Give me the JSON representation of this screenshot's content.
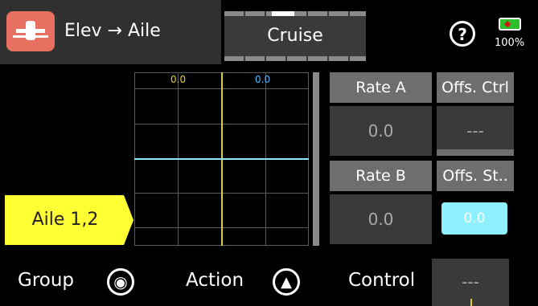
{
  "header": {
    "title": "Elev → Aile",
    "phase": "Cruise",
    "battery": "100%",
    "help_glyph": "?"
  },
  "graph": {
    "left_value": "0.0",
    "right_value": "0.0"
  },
  "side_tab": {
    "label": "Aile 1,2"
  },
  "rates": {
    "rate_a_label": "Rate A",
    "rate_a_value": "0.0",
    "rate_b_label": "Rate B",
    "rate_b_value": "0.0",
    "offs_ctrl_label": "Offs. Ctrl",
    "offs_ctrl_value": "---",
    "offs_st_label": "Offs. St..",
    "offs_st_value": "0.0"
  },
  "bottom": {
    "group_label": "Group",
    "action_label": "Action",
    "control_label": "Control",
    "control_value": "---"
  },
  "icons": {
    "app": "elev-aile-mixer-icon",
    "help": "help-icon",
    "battery": "battery-icon",
    "group": "globe-icon",
    "action": "action-icon"
  },
  "colors": {
    "accent_yellow": "#ffff33",
    "app_icon_bg": "#e87060",
    "curve": "#8fe7ff",
    "offset_field": "#8ff0ff"
  }
}
